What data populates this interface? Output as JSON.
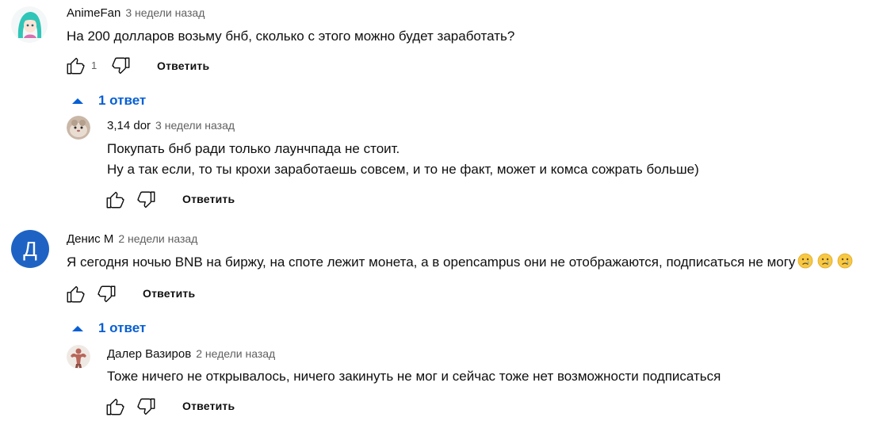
{
  "comments": [
    {
      "author": "AnimeFan",
      "time": "3 недели назад",
      "text": "На 200 долларов возьму бнб, сколько с этого можно будет заработать?",
      "likes": "1",
      "reply_label": "Ответить",
      "replies_toggle": "1 ответ",
      "reply": {
        "author": "3,14 dor",
        "time": "3 недели назад",
        "lines": [
          "Покупать бнб ради только лаунчпада не стоит.",
          "Ну а так если, то ты крохи заработаешь совсем, и то не факт, может и комса сожрать больше)"
        ],
        "reply_label": "Ответить"
      }
    },
    {
      "author": "Денис М",
      "avatar_letter": "Д",
      "time": "2 недели назад",
      "text": "Я сегодня ночью BNB на биржу, на споте лежит монета, а в opencampus они не отображаются, подписаться не могу",
      "emojis": [
        "crying-face",
        "crying-face",
        "crying-face"
      ],
      "reply_label": "Ответить",
      "replies_toggle": "1 ответ",
      "reply": {
        "author": "Далер Вазиров",
        "time": "2 недели назад",
        "text": "Тоже ничего не открывалось, ничего закинуть не мог и сейчас тоже нет возможности подписаться",
        "reply_label": "Ответить"
      }
    }
  ],
  "colors": {
    "link_blue": "#065fd4",
    "avatar_blue": "#1e63c4",
    "meta_gray": "#606060"
  }
}
